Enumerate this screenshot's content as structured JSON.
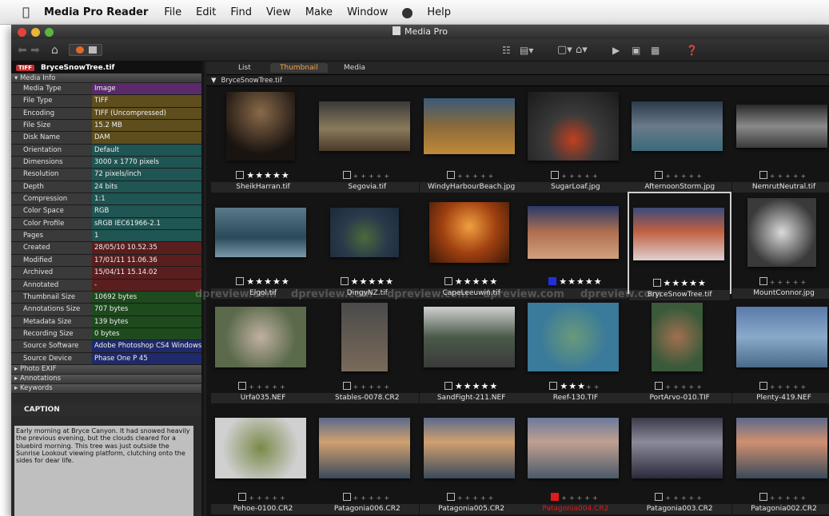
{
  "menubar": {
    "app": "Media Pro Reader",
    "items": [
      "File",
      "Edit",
      "Find",
      "View",
      "Make",
      "Window",
      "Help"
    ]
  },
  "window": {
    "title": "Media Pro"
  },
  "file_header": {
    "tag": "TIFF",
    "name": "BryceSnowTree.tif"
  },
  "sections": {
    "media_info": "Media Info",
    "photo_exif": "Photo EXIF",
    "annotations": "Annotations",
    "keywords": "Keywords",
    "caption": "CAPTION"
  },
  "info_rows": [
    {
      "k": "Media Type",
      "v": "Image",
      "c": "#5b2a6b"
    },
    {
      "k": "File Type",
      "v": "TIFF",
      "c": "#5e4e1e"
    },
    {
      "k": "Encoding",
      "v": "TIFF (Uncompressed)",
      "c": "#5e4e1e"
    },
    {
      "k": "File Size",
      "v": "15.2 MB",
      "c": "#5e4e1e"
    },
    {
      "k": "Disk Name",
      "v": "DAM",
      "c": "#5e4e1e"
    },
    {
      "k": "Orientation",
      "v": "Default",
      "c": "#1f5552"
    },
    {
      "k": "Dimensions",
      "v": "3000 x 1770 pixels",
      "c": "#1f5552"
    },
    {
      "k": "Resolution",
      "v": "72 pixels/inch",
      "c": "#1f5552"
    },
    {
      "k": "Depth",
      "v": "24 bits",
      "c": "#1f5552"
    },
    {
      "k": "Compression",
      "v": "1:1",
      "c": "#1f5552"
    },
    {
      "k": "Color Space",
      "v": "RGB",
      "c": "#1f5552"
    },
    {
      "k": "Color Profile",
      "v": "sRGB IEC61966-2.1",
      "c": "#1f5552"
    },
    {
      "k": "Pages",
      "v": "1",
      "c": "#1f5552"
    },
    {
      "k": "Created",
      "v": "28/05/10 10.52.35",
      "c": "#5a1e1e"
    },
    {
      "k": "Modified",
      "v": "17/01/11 11.06.36",
      "c": "#5a1e1e"
    },
    {
      "k": "Archived",
      "v": "15/04/11 15.14.02",
      "c": "#5a1e1e"
    },
    {
      "k": "Annotated",
      "v": "-",
      "c": "#5a1e1e"
    },
    {
      "k": "Thumbnail Size",
      "v": "10692 bytes",
      "c": "#1e4a1e"
    },
    {
      "k": "Annotations Size",
      "v": "707 bytes",
      "c": "#1e4a1e"
    },
    {
      "k": "Metadata Size",
      "v": "139 bytes",
      "c": "#1e4a1e"
    },
    {
      "k": "Recording Size",
      "v": "0 bytes",
      "c": "#1e4a1e"
    },
    {
      "k": "Source Software",
      "v": "Adobe Photoshop CS4 Windows",
      "c": "#1e2a6a"
    },
    {
      "k": "Source Device",
      "v": "Phase One P 45",
      "c": "#1e2a6a"
    }
  ],
  "caption_text": "Early morning at Bryce Canyon. It had snowed heavily the previous evening, but the clouds cleared for a bluebird morning. This tree was just outside the Sunrise Lookout viewing platform, clutching onto the sides for dear life.",
  "tabs": [
    "List",
    "Thumbnail",
    "Media"
  ],
  "active_tab": "Thumbnail",
  "path": "BryceSnowTree.tif",
  "watermark": "dpreview.com",
  "colors": {
    "accent": "#f3a23a",
    "label_red": "#e01a1a",
    "label_blue": "#2030e0"
  },
  "thumbnails": [
    {
      "name": "SheikHarran.tif",
      "stars": 5,
      "label": "",
      "sel": false
    },
    {
      "name": "Segovia.tif",
      "stars": 0,
      "label": "",
      "sel": false
    },
    {
      "name": "WindyHarbourBeach.jpg",
      "stars": 0,
      "label": "",
      "sel": false
    },
    {
      "name": "SugarLoaf.jpg",
      "stars": 0,
      "label": "",
      "sel": false
    },
    {
      "name": "AfternoonStorm.jpg",
      "stars": 0,
      "label": "",
      "sel": false
    },
    {
      "name": "NemrutNeutral.tif",
      "stars": 0,
      "label": "",
      "sel": false
    },
    {
      "name": "Elgol.tif",
      "stars": 5,
      "label": "",
      "sel": false
    },
    {
      "name": "DingyNZ.tif",
      "stars": 5,
      "label": "",
      "sel": false
    },
    {
      "name": "CapeLeeuwin.tif",
      "stars": 5,
      "label": "",
      "sel": false
    },
    {
      "name": "",
      "stars": 5,
      "label": "blue",
      "sel": false
    },
    {
      "name": "BryceSnowTree.tif",
      "stars": 5,
      "label": "",
      "sel": true
    },
    {
      "name": "MountConnor.jpg",
      "stars": 0,
      "label": "",
      "sel": false
    },
    {
      "name": "Urfa035.NEF",
      "stars": 0,
      "label": "",
      "sel": false
    },
    {
      "name": "Stables-0078.CR2",
      "stars": 0,
      "label": "",
      "sel": false
    },
    {
      "name": "SandFight-211.NEF",
      "stars": 5,
      "label": "",
      "sel": false
    },
    {
      "name": "Reef-130.TIF",
      "stars": 3,
      "label": "",
      "sel": false
    },
    {
      "name": "PortArvo-010.TIF",
      "stars": 0,
      "label": "",
      "sel": false
    },
    {
      "name": "Plenty-419.NEF",
      "stars": 0,
      "label": "",
      "sel": false
    },
    {
      "name": "Pehoe-0100.CR2",
      "stars": 0,
      "label": "",
      "sel": false
    },
    {
      "name": "Patagonia006.CR2",
      "stars": 0,
      "label": "",
      "sel": false
    },
    {
      "name": "Patagonia005.CR2",
      "stars": 0,
      "label": "",
      "sel": false
    },
    {
      "name": "Patagonia004.CR2",
      "stars": 0,
      "label": "red",
      "sel": false
    },
    {
      "name": "Patagonia003.CR2",
      "stars": 0,
      "label": "",
      "sel": false
    },
    {
      "name": "Patagonia002.CR2",
      "stars": 0,
      "label": "",
      "sel": false
    }
  ]
}
